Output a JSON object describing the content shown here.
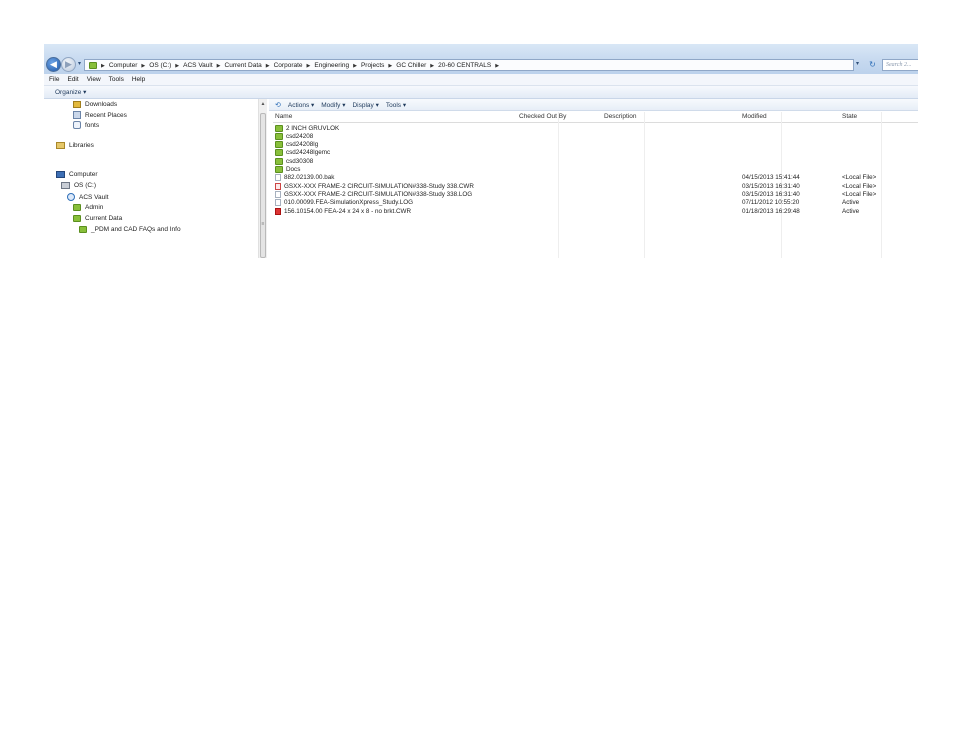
{
  "address_bar": {
    "breadcrumb": [
      "Computer",
      "OS (C:)",
      "ACS Vault",
      "Current Data",
      "Corporate",
      "Engineering",
      "Projects",
      "GC Chiller",
      "20-60 CENTRALS"
    ],
    "search_placeholder": "Search 2...",
    "icons": {
      "back": "back-arrow-icon",
      "forward": "forward-arrow-icon",
      "refresh": "refresh-icon"
    }
  },
  "menu": [
    "File",
    "Edit",
    "View",
    "Tools",
    "Help"
  ],
  "command_bar": {
    "organize": "Organize ▾"
  },
  "nav_pane": {
    "items": [
      {
        "label": "Downloads",
        "icon": "downloads-folder-icon"
      },
      {
        "label": "Recent Places",
        "icon": "recent-places-icon"
      },
      {
        "label": "fonts",
        "icon": "fonts-icon"
      },
      {
        "label": "Libraries",
        "icon": "libraries-icon"
      },
      {
        "label": "Computer",
        "icon": "computer-icon"
      },
      {
        "label": "OS (C:)",
        "icon": "drive-icon"
      },
      {
        "label": "ACS Vault",
        "icon": "vault-icon"
      },
      {
        "label": "Admin",
        "icon": "folder-icon"
      },
      {
        "label": "Current Data",
        "icon": "folder-icon"
      },
      {
        "label": "_PDM and CAD FAQs and Info",
        "icon": "folder-icon"
      }
    ]
  },
  "pdm_toolbar": [
    "Actions ▾",
    "Modify ▾",
    "Display ▾",
    "Tools ▾"
  ],
  "columns": {
    "name": "Name",
    "checked_out_by": "Checked Out By",
    "description": "Description",
    "modified": "Modified",
    "state": "State"
  },
  "files": [
    {
      "name": "2 INCH GRUVLOK",
      "modified": "",
      "state": "",
      "type": "folder"
    },
    {
      "name": "csd24208",
      "modified": "",
      "state": "",
      "type": "folder"
    },
    {
      "name": "csd24208lg",
      "modified": "",
      "state": "",
      "type": "folder"
    },
    {
      "name": "csd24248lgemc",
      "modified": "",
      "state": "",
      "type": "folder"
    },
    {
      "name": "csd30308",
      "modified": "",
      "state": "",
      "type": "folder"
    },
    {
      "name": "Docs",
      "modified": "",
      "state": "",
      "type": "folder"
    },
    {
      "name": "882.02139.00.bak",
      "modified": "04/15/2013 15:41:44",
      "state": "<Local File>",
      "type": "file"
    },
    {
      "name": "GSXX-XXX FRAME-2 CIRCUIT-SIMULATION#338-Study 338.CWR",
      "modified": "03/15/2013 16:31:40",
      "state": "<Local File>",
      "type": "cwr"
    },
    {
      "name": "GSXX-XXX FRAME-2 CIRCUIT-SIMULATION#338-Study 338.LOG",
      "modified": "03/15/2013 16:31:40",
      "state": "<Local File>",
      "type": "file"
    },
    {
      "name": "010.00099.FEA-SimulationXpress_Study.LOG",
      "modified": "07/11/2012 10:55:20",
      "state": "Active",
      "type": "file"
    },
    {
      "name": "156.10154.00 FEA-24 x 24 x 8 - no brkt.CWR",
      "modified": "01/18/2013 16:29:48",
      "state": "Active",
      "type": "red"
    }
  ]
}
